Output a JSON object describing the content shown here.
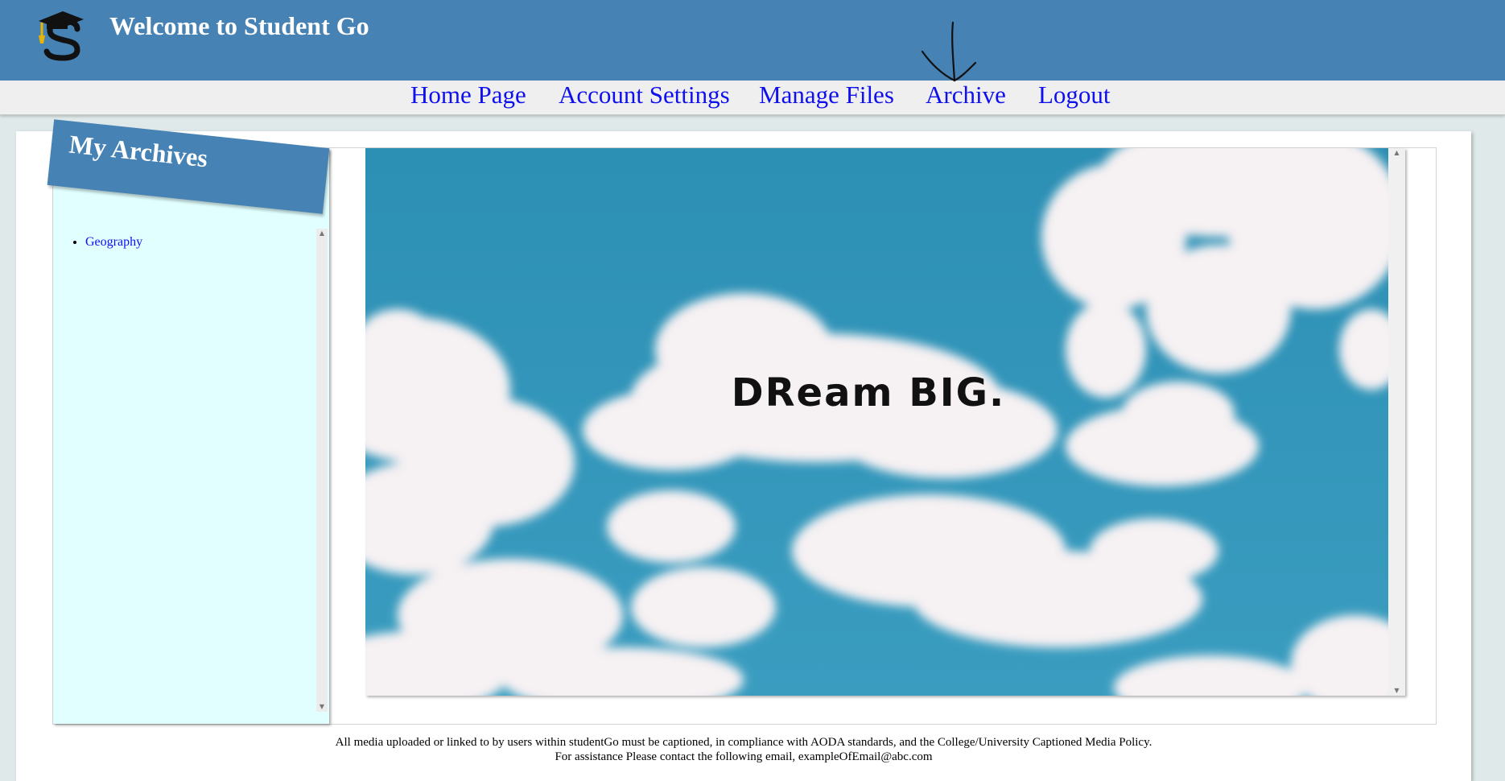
{
  "header": {
    "title": "Welcome to Student Go",
    "logo_icon": "graduation-cap-s-logo",
    "background_color": "#4682b4"
  },
  "nav": {
    "items": [
      {
        "label": "Home Page"
      },
      {
        "label": "Account Settings"
      },
      {
        "label": "Manage Files"
      },
      {
        "label": "Archive"
      },
      {
        "label": "Logout"
      }
    ],
    "link_color": "#1010ee",
    "annotation_icon": "hand-drawn-arrow-down-icon"
  },
  "sidebar": {
    "title": "My Archives",
    "items": [
      {
        "label": "Geography"
      }
    ],
    "background_color": "#e1ffff"
  },
  "viewer": {
    "image_text": "DReam BIG.",
    "image_description_icon": "sky-clouds-image"
  },
  "footer": {
    "line1": "All media uploaded or linked to by users within studentGo must be captioned, in compliance with AODA standards, and the College/University Captioned Media Policy.",
    "line2": "For assistance Please contact the following email, exampleOfEmail@abc.com"
  }
}
